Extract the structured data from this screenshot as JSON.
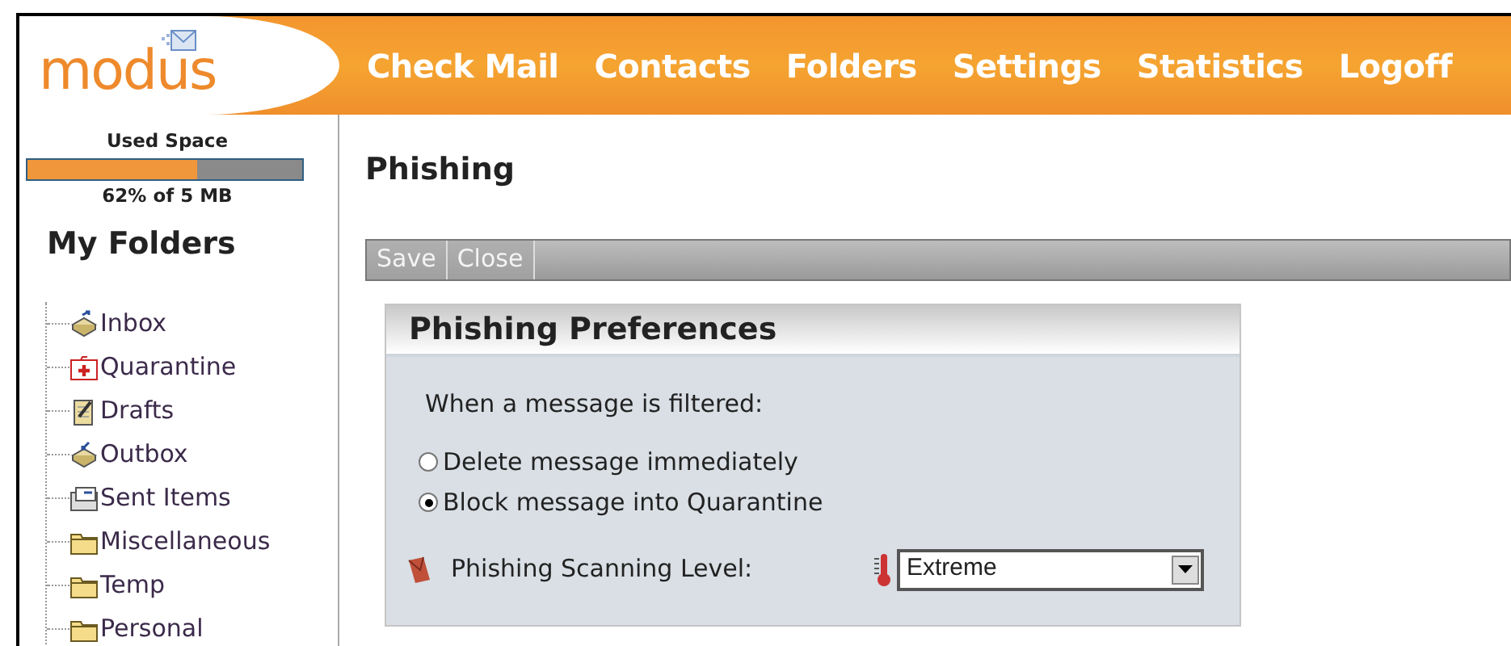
{
  "logo": {
    "text": "modus"
  },
  "nav": [
    "Check Mail",
    "Contacts",
    "Folders",
    "Settings",
    "Statistics",
    "Logoff"
  ],
  "used_space": {
    "label": "Used Space",
    "level": 0.62,
    "reading": "62% of 5 MB"
  },
  "folders_title": "My Folders",
  "folders": [
    {
      "name": "Inbox",
      "kind": "inbox"
    },
    {
      "name": "Quarantine",
      "kind": "quarantine"
    },
    {
      "name": "Drafts",
      "kind": "drafts"
    },
    {
      "name": "Outbox",
      "kind": "outbox"
    },
    {
      "name": "Sent Items",
      "kind": "sent"
    },
    {
      "name": "Miscellaneous",
      "kind": "folder"
    },
    {
      "name": "Temp",
      "kind": "folder"
    },
    {
      "name": "Personal",
      "kind": "folder"
    }
  ],
  "page_title": "Phishing",
  "toolbar": [
    "Save",
    "Close"
  ],
  "panel": {
    "title": "Phishing Preferences",
    "prompt": "When a message is filtered:",
    "options": [
      {
        "label": "Delete message immediately",
        "selected": false
      },
      {
        "label": "Block message into Quarantine",
        "selected": true
      }
    ],
    "level_label": "Phishing Scanning Level:",
    "level_value": "Extreme"
  }
}
